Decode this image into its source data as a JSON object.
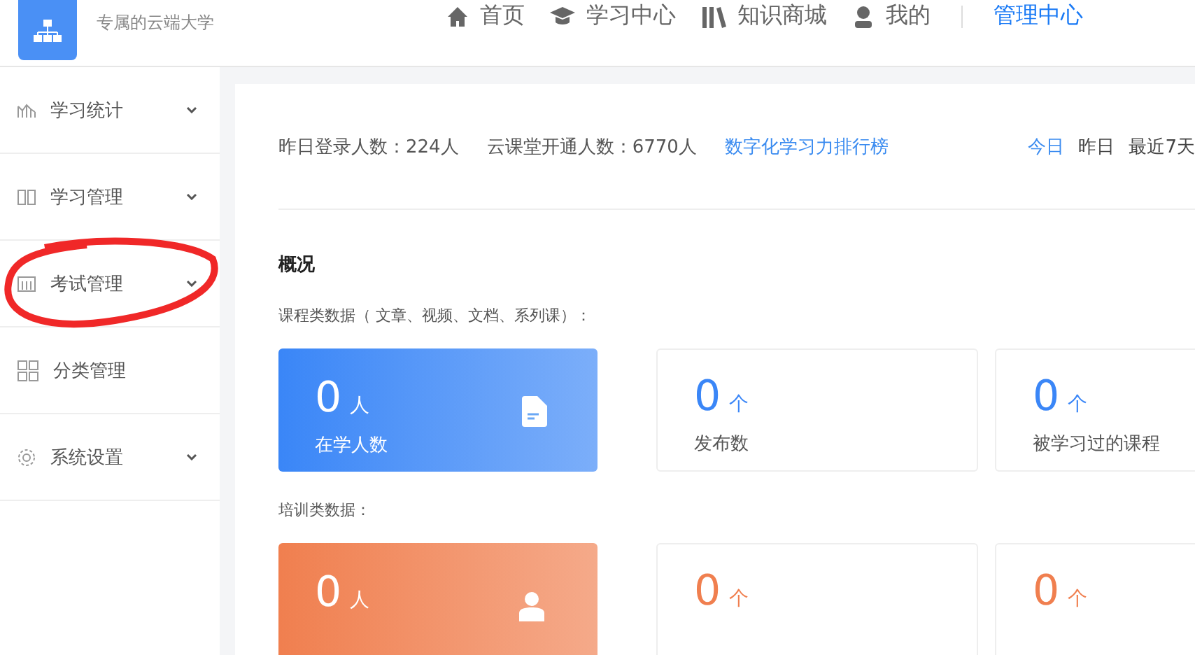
{
  "header": {
    "subtitle": "专属的云端大学",
    "nav": [
      {
        "label": "首页",
        "selected": false
      },
      {
        "label": "学习中心",
        "selected": false
      },
      {
        "label": "知识商城",
        "selected": false
      },
      {
        "label": "我的",
        "selected": false
      },
      {
        "label": "管理中心",
        "selected": true
      }
    ]
  },
  "sidebar": {
    "items": [
      {
        "label": "学习统计",
        "expandable": true,
        "circled": false
      },
      {
        "label": "学习管理",
        "expandable": true,
        "circled": false
      },
      {
        "label": "考试管理",
        "expandable": true,
        "circled": true
      },
      {
        "label": "分类管理",
        "expandable": false,
        "circled": false
      },
      {
        "label": "系统设置",
        "expandable": true,
        "circled": false
      }
    ]
  },
  "stats_bar": {
    "items": [
      "昨日登录人数：224人",
      "云课堂开通人数：6770人"
    ],
    "link": "数字化学习力排行榜",
    "periods": [
      {
        "label": "今日",
        "selected": true
      },
      {
        "label": "昨日",
        "selected": false
      },
      {
        "label": "最近7天",
        "selected": false
      }
    ]
  },
  "overview": {
    "title": "概况",
    "sections": [
      {
        "label": "课程类数据（ 文章、视频、文档、系列课）：",
        "color": "#3a86f7",
        "cards": [
          {
            "kind": "highlight",
            "value": "0",
            "unit": "人",
            "label": "在学人数"
          },
          {
            "kind": "plain",
            "value": "0",
            "unit": "个",
            "label": "发布数"
          },
          {
            "kind": "plain",
            "value": "0",
            "unit": "个",
            "label": "被学习过的课程"
          }
        ]
      },
      {
        "label": "培训类数据：",
        "color": "#f07f4f",
        "cards": [
          {
            "kind": "highlight",
            "value": "0",
            "unit": "人"
          },
          {
            "kind": "plain",
            "value": "0",
            "unit": "个"
          },
          {
            "kind": "plain",
            "value": "0",
            "unit": "个"
          }
        ]
      }
    ]
  }
}
